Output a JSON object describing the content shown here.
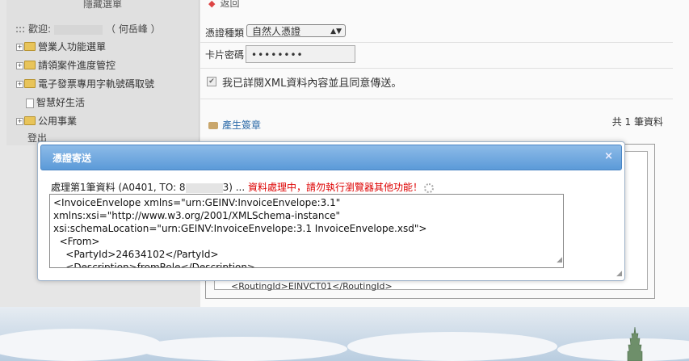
{
  "sidebar": {
    "header": "隱藏選單",
    "welcome_prefix": "::: 歡迎:",
    "welcome_name": "（ 何岳峰 ）",
    "items": [
      {
        "label": "營業人功能選單",
        "type": "folder"
      },
      {
        "label": "請領案件進度管控",
        "type": "folder"
      },
      {
        "label": "電子發票專用字軌號碼取號",
        "type": "folder"
      },
      {
        "label": "智慧好生活",
        "type": "doc"
      },
      {
        "label": "公用事業",
        "type": "folder"
      }
    ],
    "logout": "登出"
  },
  "main": {
    "back": "返回",
    "cert_type_label": "憑證種類",
    "cert_type_value": "自然人憑證",
    "pin_label": "卡片密碼",
    "pin_value": "••••••••",
    "agree_label": "我已詳閱XML資料內容並且同意傳送。",
    "sign_link": "產生簽章",
    "count": "共 1 筆資料",
    "routing": "<RoutingId>EINVCT01</RoutingId>"
  },
  "dialog": {
    "title": "憑證寄送",
    "close": "×",
    "status_prefix": "處理第1筆資料 (A0401, TO: 8",
    "status_suffix": "3) ... ",
    "status_warning": "資料處理中，請勿執行瀏覽器其他功能！",
    "xml_lines": [
      "<InvoiceEnvelope xmlns=\"urn:GEINV:InvoiceEnvelope:3.1\"",
      "xmlns:xsi=\"http://www.w3.org/2001/XMLSchema-instance\"",
      "xsi:schemaLocation=\"urn:GEINV:InvoiceEnvelope:3.1 InvoiceEnvelope.xsd\">",
      "  <From>",
      "    <PartyId>24634102</PartyId>",
      "    <Description>fromRole</Description>"
    ]
  }
}
